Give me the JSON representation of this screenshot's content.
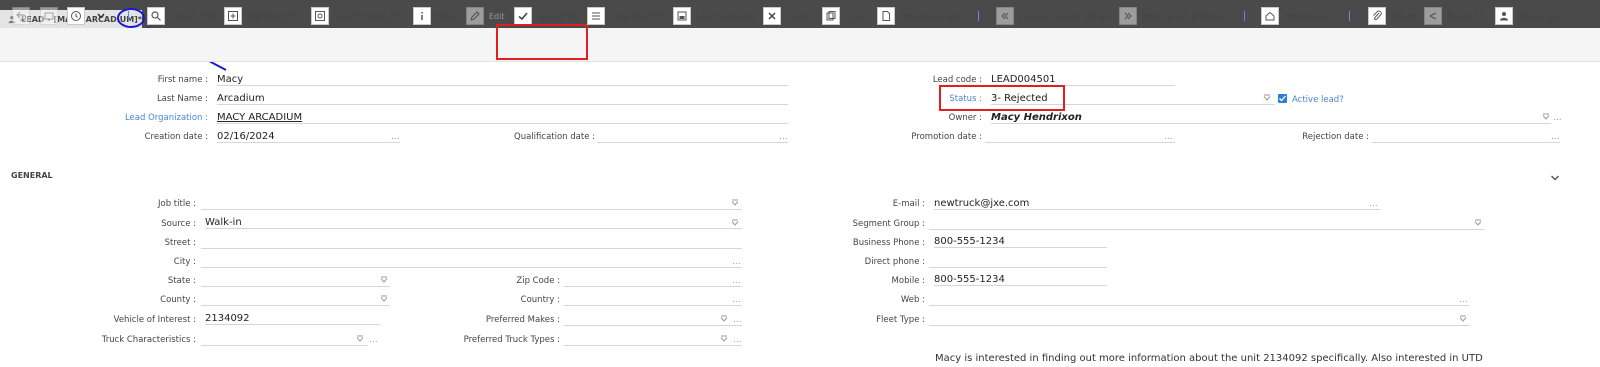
{
  "tab": {
    "title": "LEAD - [MACY ARCADIUM]*"
  },
  "toolbar": {
    "search": "Search (F4)",
    "add_new": "Add New (F6)",
    "search_mode": "Search mode (F7)",
    "view": "View",
    "edit": "Edit",
    "save": "Save (F10)",
    "selection": "Selection (F3)",
    "load_template": "Load template",
    "delete": "Delete",
    "copy": "Copy",
    "new_document": "New document",
    "previous_record": "Previous record (PgUp)",
    "next_record": "Next record (PgDwn)",
    "home_page": "Home page",
    "attach": "Attach",
    "relate_to": "Relate to",
    "resources": "Resources"
  },
  "header": {
    "first_name_label": "First name :",
    "first_name": "Macy",
    "last_name_label": "Last Name :",
    "last_name": "Arcadium",
    "lead_org_label": "Lead Organization :",
    "lead_org": "MACY ARCADIUM",
    "creation_date_label": "Creation date :",
    "creation_date": "02/16/2024",
    "qualification_date_label": "Qualification date :",
    "qualification_date": "",
    "lead_code_label": "Lead code :",
    "lead_code": "LEAD004501",
    "status_label": "Status :",
    "status": "3- Rejected",
    "active_lead_label": "Active lead?",
    "active_lead": true,
    "owner_label": "Owner :",
    "owner": "Macy Hendrixon",
    "promotion_date_label": "Promotion date :",
    "rejection_date_label": "Rejection date :"
  },
  "general": {
    "section_title": "GENERAL",
    "job_title_label": "Job title :",
    "source_label": "Source :",
    "source": "Walk-in",
    "street_label": "Street :",
    "city_label": "City :",
    "state_label": "State :",
    "zip_label": "Zip Code :",
    "county_label": "County :",
    "country_label": "Country :",
    "vehicle_label": "Vehicle of Interest :",
    "vehicle": "2134092",
    "preferred_makes_label": "Preferred Makes :",
    "truck_char_label": "Truck Characteristics :",
    "preferred_truck_types_label": "Preferred Truck Types :",
    "email_label": "E-mail :",
    "email": "newtruck@jxe.com",
    "segment_group_label": "Segment Group :",
    "business_phone_label": "Business Phone :",
    "business_phone": "800-555-1234",
    "direct_phone_label": "Direct phone :",
    "mobile_label": "Mobile :",
    "mobile": "800-555-1234",
    "web_label": "Web :",
    "fleet_type_label": "Fleet Type :",
    "note": "Macy is interested in finding out more information about the unit 2134092 specifically. Also interested in UTD"
  },
  "colors": {
    "annotation_red": "#e02020",
    "annotation_blue": "#1a1ad6",
    "link_blue": "#4a86d2"
  }
}
